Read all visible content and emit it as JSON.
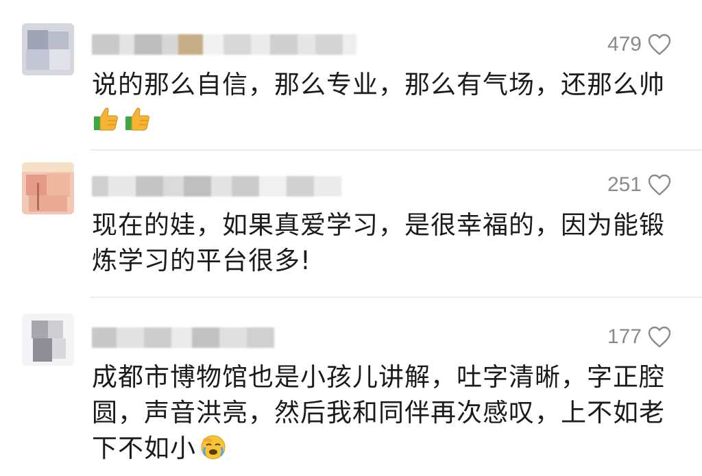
{
  "comments": [
    {
      "likes": "479",
      "text": "说的那么自信，那么专业，那么有气场，还那么帅",
      "emojis": [
        "thumbs-up-icon",
        "thumbs-up-icon"
      ]
    },
    {
      "likes": "251",
      "text_line1": "现在的娃，如果真爱学习，是很幸福的，因为能锻",
      "text_line2": "炼学习的平台很多!"
    },
    {
      "likes": "177",
      "text_line1": "成都市博物馆也是小孩儿讲解，吐字清晰，字正腔",
      "text_line2": "圆，声音洪亮，然后我和同伴再次感叹，上不如老",
      "text_line3": "下不如小",
      "emojis": [
        "facepalm-crying-icon"
      ]
    }
  ],
  "colors": {
    "text": "#1b1b1b",
    "meta": "#8a8a8a",
    "divider": "#ececec"
  }
}
